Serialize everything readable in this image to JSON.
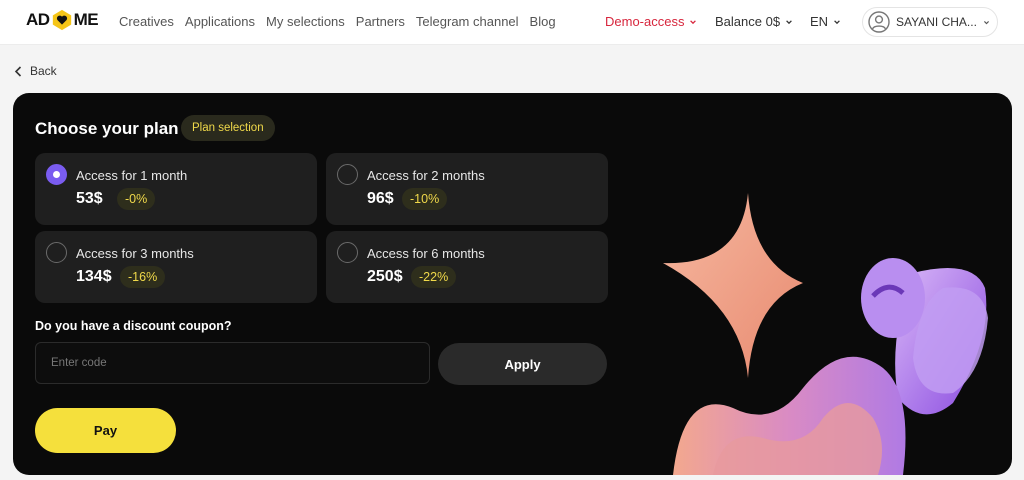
{
  "header": {
    "logo_left": "AD",
    "logo_right": "ME",
    "nav": [
      "Creatives",
      "Applications",
      "My selections",
      "Partners",
      "Telegram channel",
      "Blog"
    ],
    "demo_access": "Demo-access",
    "balance": "Balance 0$",
    "language": "EN",
    "user_name": "SAYANI CHA..."
  },
  "back_label": "Back",
  "plan_section": {
    "title": "Choose your plan",
    "badge": "Plan selection",
    "plans": [
      {
        "label": "Access for 1 month",
        "price": "53$",
        "discount": "-0%",
        "selected": true
      },
      {
        "label": "Access for 2 months",
        "price": "96$",
        "discount": "-10%",
        "selected": false
      },
      {
        "label": "Access for 3 months",
        "price": "134$",
        "discount": "-16%",
        "selected": false
      },
      {
        "label": "Access for 6 months",
        "price": "250$",
        "discount": "-22%",
        "selected": false
      }
    ]
  },
  "coupon": {
    "question": "Do you have a discount coupon?",
    "placeholder": "Enter code",
    "apply_label": "Apply"
  },
  "pay_label": "Pay",
  "colors": {
    "accent_yellow": "#f5e03c",
    "radio_selected": "#7a5cf0",
    "demo_red": "#d7263d",
    "card_bg": "#0a0a0a"
  }
}
